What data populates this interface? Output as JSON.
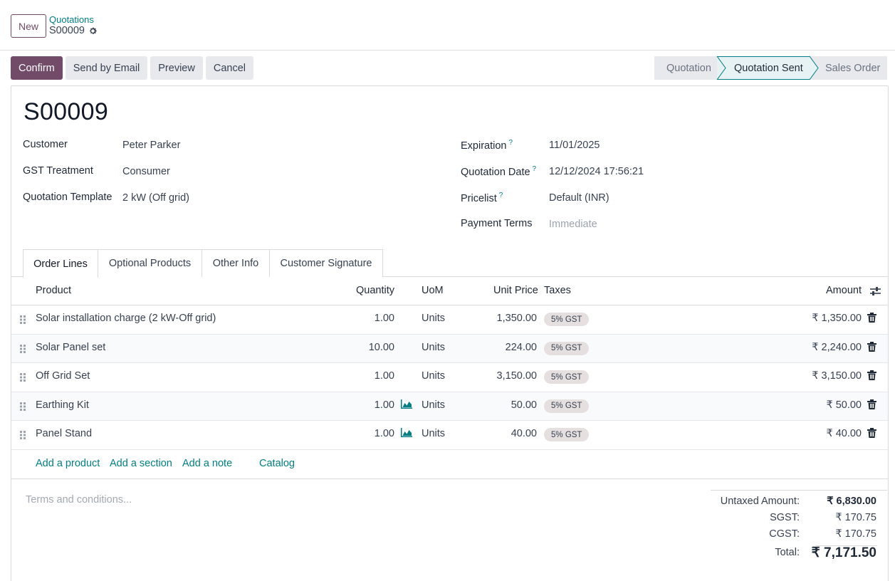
{
  "header": {
    "new_label": "New",
    "breadcrumb": "Quotations",
    "record_name": "S00009"
  },
  "actions": {
    "confirm": "Confirm",
    "send_email": "Send by Email",
    "preview": "Preview",
    "cancel": "Cancel"
  },
  "statusbar": {
    "stages": [
      "Quotation",
      "Quotation Sent",
      "Sales Order"
    ],
    "current": "Quotation Sent"
  },
  "form": {
    "title": "S00009",
    "left": {
      "customer_label": "Customer",
      "customer": "Peter Parker",
      "gst_label": "GST Treatment",
      "gst": "Consumer",
      "template_label": "Quotation Template",
      "template": "2 kW (Off grid)"
    },
    "right": {
      "expiration_label": "Expiration",
      "expiration": "11/01/2025",
      "qdate_label": "Quotation Date",
      "qdate": "12/12/2024 17:56:21",
      "pricelist_label": "Pricelist",
      "pricelist": "Default (INR)",
      "payment_label": "Payment Terms",
      "payment_placeholder": "Immediate",
      "help_mark": "?"
    }
  },
  "tabs": [
    "Order Lines",
    "Optional Products",
    "Other Info",
    "Customer Signature"
  ],
  "table": {
    "headers": {
      "product": "Product",
      "quantity": "Quantity",
      "uom": "UoM",
      "unit_price": "Unit Price",
      "taxes": "Taxes",
      "amount": "Amount"
    },
    "rows": [
      {
        "product": "Solar installation charge (2 kW-Off grid)",
        "quantity": "1.00",
        "uom": "Units",
        "unit_price": "1,350.00",
        "tax": "5% GST",
        "amount": "₹ 1,350.00",
        "forecast": false
      },
      {
        "product": "Solar Panel set",
        "quantity": "10.00",
        "uom": "Units",
        "unit_price": "224.00",
        "tax": "5% GST",
        "amount": "₹ 2,240.00",
        "forecast": false
      },
      {
        "product": "Off Grid Set",
        "quantity": "1.00",
        "uom": "Units",
        "unit_price": "3,150.00",
        "tax": "5% GST",
        "amount": "₹ 3,150.00",
        "forecast": false
      },
      {
        "product": "Earthing Kit",
        "quantity": "1.00",
        "uom": "Units",
        "unit_price": "50.00",
        "tax": "5% GST",
        "amount": "₹ 50.00",
        "forecast": true
      },
      {
        "product": "Panel Stand",
        "quantity": "1.00",
        "uom": "Units",
        "unit_price": "40.00",
        "tax": "5% GST",
        "amount": "₹ 40.00",
        "forecast": true
      }
    ],
    "add_links": {
      "product": "Add a product",
      "section": "Add a section",
      "note": "Add a note",
      "catalog": "Catalog"
    }
  },
  "terms_placeholder": "Terms and conditions...",
  "totals": {
    "untaxed_label": "Untaxed Amount:",
    "untaxed": "₹ 6,830.00",
    "sgst_label": "SGST:",
    "sgst": "₹ 170.75",
    "cgst_label": "CGST:",
    "cgst": "₹ 170.75",
    "total_label": "Total:",
    "total": "₹ 7,171.50"
  },
  "colors": {
    "primary": "#714b67",
    "link": "#017e84",
    "tax_badge": "#e5dfdf"
  }
}
